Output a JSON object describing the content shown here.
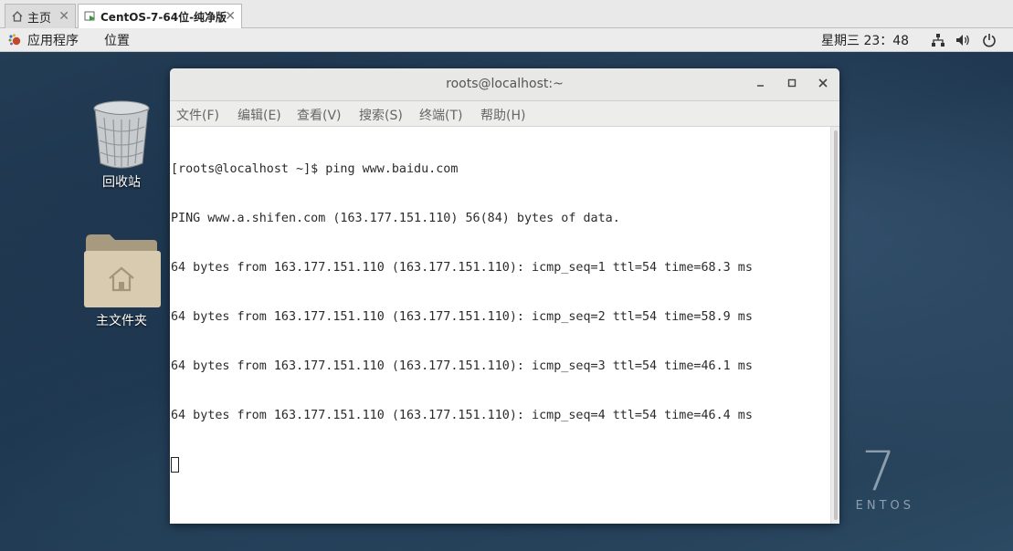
{
  "vm_tabs": [
    {
      "label": "主页",
      "icon": "home-icon"
    },
    {
      "label": "CentOS-7-64位-纯净版",
      "icon": "vm-icon"
    }
  ],
  "panel": {
    "applications": "应用程序",
    "places": "位置",
    "clock": "星期三 23：48",
    "icons": [
      "network-icon",
      "volume-icon",
      "power-icon"
    ]
  },
  "desktop": {
    "trash_label": "回收站",
    "home_label": "主文件夹",
    "centos_number": "7",
    "centos_text": "ENTOS"
  },
  "terminal": {
    "title": "roots@localhost:~",
    "menu": [
      "文件(F)",
      "编辑(E)",
      "查看(V)",
      "搜索(S)",
      "终端(T)",
      "帮助(H)"
    ],
    "lines": [
      "[roots@localhost ~]$ ping www.baidu.com",
      "PING www.a.shifen.com (163.177.151.110) 56(84) bytes of data.",
      "64 bytes from 163.177.151.110 (163.177.151.110): icmp_seq=1 ttl=54 time=68.3 ms",
      "64 bytes from 163.177.151.110 (163.177.151.110): icmp_seq=2 ttl=54 time=58.9 ms",
      "64 bytes from 163.177.151.110 (163.177.151.110): icmp_seq=3 ttl=54 time=46.1 ms",
      "64 bytes from 163.177.151.110 (163.177.151.110): icmp_seq=4 ttl=54 time=46.4 ms"
    ]
  }
}
